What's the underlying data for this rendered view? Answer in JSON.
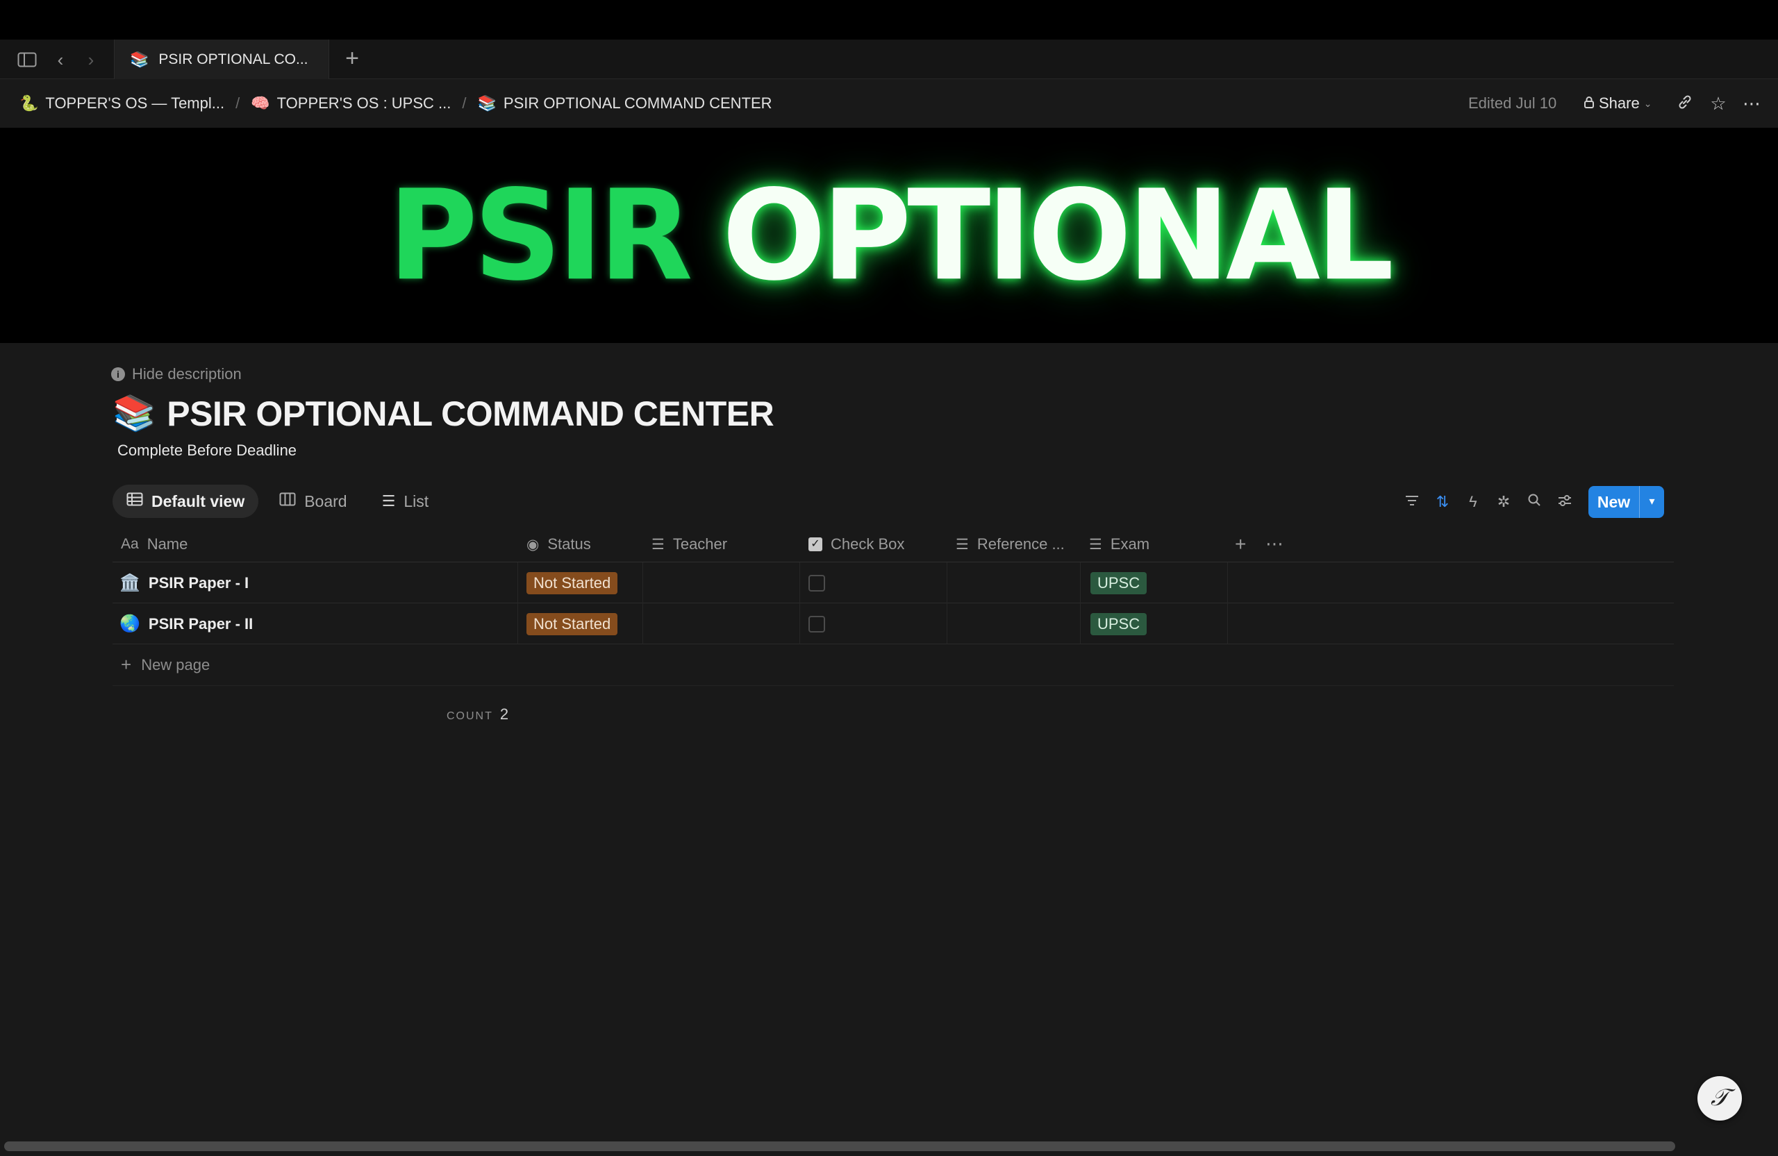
{
  "tabbar": {
    "tab_emoji": "📚",
    "tab_title": "PSIR OPTIONAL CO...",
    "new_tab_glyph": "+"
  },
  "breadcrumbs": [
    {
      "emoji": "🐍",
      "label": "TOPPER'S OS — Templ..."
    },
    {
      "emoji": "🧠",
      "label": "TOPPER'S OS : UPSC ..."
    },
    {
      "emoji": "📚",
      "label": "PSIR OPTIONAL COMMAND CENTER"
    }
  ],
  "breadcrumb_separator": "/",
  "topbar": {
    "edited": "Edited Jul 10",
    "share_label": "Share"
  },
  "banner": {
    "word1": "PSIR",
    "word2": "OPTIONAL",
    "color_word1": "#1fd65a",
    "glow_color": "#28ff5a"
  },
  "page": {
    "hide_description": "Hide description",
    "emoji": "📚",
    "title": "PSIR OPTIONAL COMMAND CENTER",
    "description": "Complete Before Deadline"
  },
  "views": [
    {
      "label": "Default view",
      "icon": "table-icon",
      "active": true
    },
    {
      "label": "Board",
      "icon": "board-icon",
      "active": false
    },
    {
      "label": "List",
      "icon": "list-icon",
      "active": false
    }
  ],
  "toolbar": {
    "new_label": "New",
    "accent": "#2383e2"
  },
  "table": {
    "columns": [
      {
        "label": "Name",
        "icon": "text-type-icon"
      },
      {
        "label": "Status",
        "icon": "status-icon"
      },
      {
        "label": "Teacher",
        "icon": "list-icon"
      },
      {
        "label": "Check Box",
        "icon": "checkbox-icon"
      },
      {
        "label": "Reference ...",
        "icon": "list-icon"
      },
      {
        "label": "Exam",
        "icon": "list-icon"
      }
    ],
    "rows": [
      {
        "emoji": "🏛️",
        "name": "PSIR Paper - I",
        "status": "Not Started",
        "checked": false,
        "exam": "UPSC"
      },
      {
        "emoji": "🌏",
        "name": "PSIR Paper - II",
        "status": "Not Started",
        "checked": false,
        "exam": "UPSC"
      }
    ],
    "new_page": "New page",
    "count_label": "COUNT",
    "count_value": "2"
  },
  "colors": {
    "status_not_started": "#854c1d",
    "exam_upsc": "#2b593f"
  }
}
